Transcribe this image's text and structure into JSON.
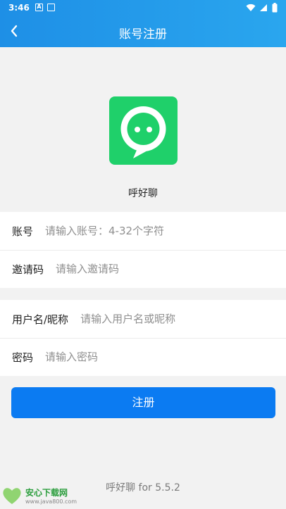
{
  "status_bar": {
    "time": "3:46",
    "left_icons": [
      "a-notification-icon",
      "calendar-notification-icon"
    ],
    "right_icons": [
      "wifi-icon",
      "cellular-signal-icon",
      "battery-icon"
    ]
  },
  "header": {
    "back_icon": "chevron-left-icon",
    "title": "账号注册",
    "gradient_start": "#1e8fe6",
    "gradient_end": "#2aa6ee"
  },
  "logo": {
    "icon": "chat-bubble-face-icon",
    "color": "#1fd06a",
    "app_name": "呼好聊"
  },
  "form": {
    "group1": [
      {
        "label": "账号",
        "placeholder": "请输入账号：4-32个字符",
        "value": ""
      },
      {
        "label": "邀请码",
        "placeholder": "请输入邀请码",
        "value": ""
      }
    ],
    "group2": [
      {
        "label": "用户名/昵称",
        "placeholder": "请输入用户名或昵称",
        "value": ""
      },
      {
        "label": "密码",
        "placeholder": "请输入密码",
        "value": ""
      }
    ]
  },
  "submit": {
    "label": "注册",
    "color": "#0b7bf2"
  },
  "footer": {
    "version": "呼好聊 for 5.5.2"
  },
  "watermark": {
    "name": "安心下载网",
    "url": "www.java800.com",
    "logo_text": "绿色免费"
  }
}
